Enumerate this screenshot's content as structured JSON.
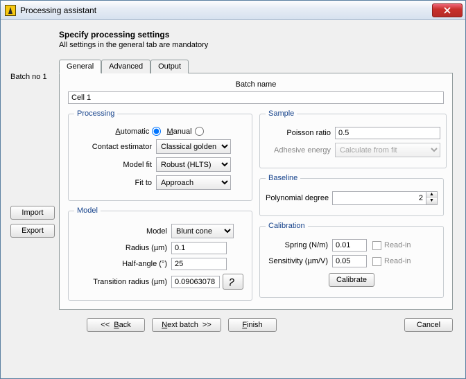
{
  "window": {
    "title": "Processing assistant"
  },
  "header": {
    "title": "Specify processing settings",
    "subtitle": "All settings in the general tab are mandatory"
  },
  "left": {
    "batch_label": "Batch no 1",
    "import": "Import",
    "export": "Export"
  },
  "tabs": {
    "general": "General",
    "advanced": "Advanced",
    "output": "Output"
  },
  "general": {
    "batch_name_label": "Batch name",
    "batch_name_value": "Cell 1",
    "processing": {
      "legend": "Processing",
      "automatic": "Automatic",
      "manual": "Manual",
      "contact_estimator_label": "Contact estimator",
      "contact_estimator_value": "Classical golden",
      "model_fit_label": "Model fit",
      "model_fit_value": "Robust (HLTS)",
      "fit_to_label": "Fit to",
      "fit_to_value": "Approach"
    },
    "sample": {
      "legend": "Sample",
      "poisson_label": "Poisson ratio",
      "poisson_value": "0.5",
      "adhesive_label": "Adhesive energy",
      "adhesive_value": "Calculate from fit"
    },
    "baseline": {
      "legend": "Baseline",
      "poly_label": "Polynomial degree",
      "poly_value": "2"
    },
    "model": {
      "legend": "Model",
      "model_label": "Model",
      "model_value": "Blunt cone",
      "radius_label": "Radius (µm)",
      "radius_value": "0.1",
      "half_angle_label": "Half-angle (°)",
      "half_angle_value": "25",
      "transition_label": "Transition radius (µm)",
      "transition_value": "0.09063078"
    },
    "calibration": {
      "legend": "Calibration",
      "spring_label": "Spring (N/m)",
      "spring_value": "0.01",
      "sensitivity_label": "Sensitivity (µm/V)",
      "sensitivity_value": "0.05",
      "readin": "Read-in",
      "calibrate": "Calibrate"
    }
  },
  "footer": {
    "back": "<<  Back",
    "next": "Next batch  >>",
    "finish": "Finish",
    "cancel": "Cancel"
  }
}
